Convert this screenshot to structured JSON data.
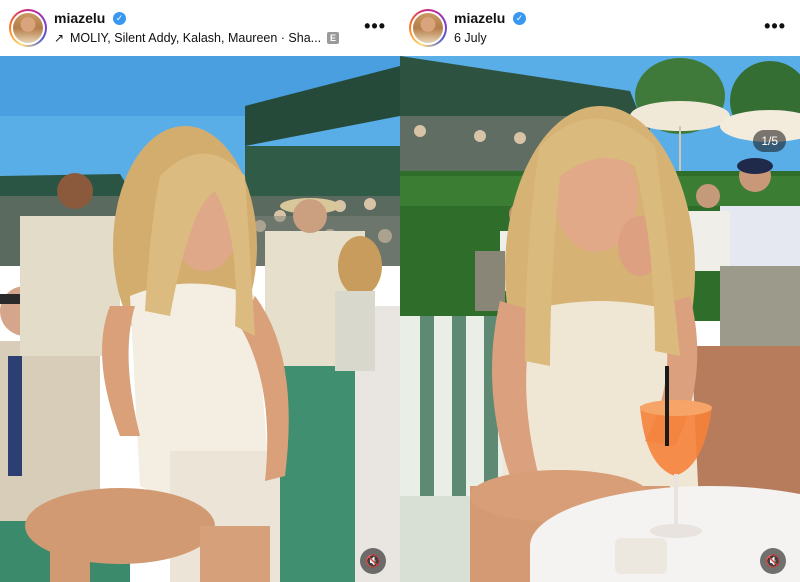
{
  "posts": [
    {
      "username": "miazelu",
      "subline": "MOLIY, Silent Addy, Kalash, Maureen · Sha...",
      "subline_badge": "E",
      "subline_icon": "arrow-up-right-icon",
      "more_icon": "more-options-icon",
      "more_label": "•••",
      "mute_icon": "speaker-muted-icon",
      "mute_label": "🔇"
    },
    {
      "username": "miazelu",
      "subline": "6 July",
      "more_icon": "more-options-icon",
      "more_label": "•••",
      "carousel_counter": "1/5",
      "mute_icon": "speaker-muted-icon",
      "mute_label": "🔇"
    }
  ],
  "colors": {
    "verified_blue": "#3897f0",
    "sky": "#4fa7e6",
    "court_green": "#3e8a6e",
    "dress": "#f3ede2",
    "hair": "#d9b67a",
    "hedge": "#2f6e2a"
  }
}
